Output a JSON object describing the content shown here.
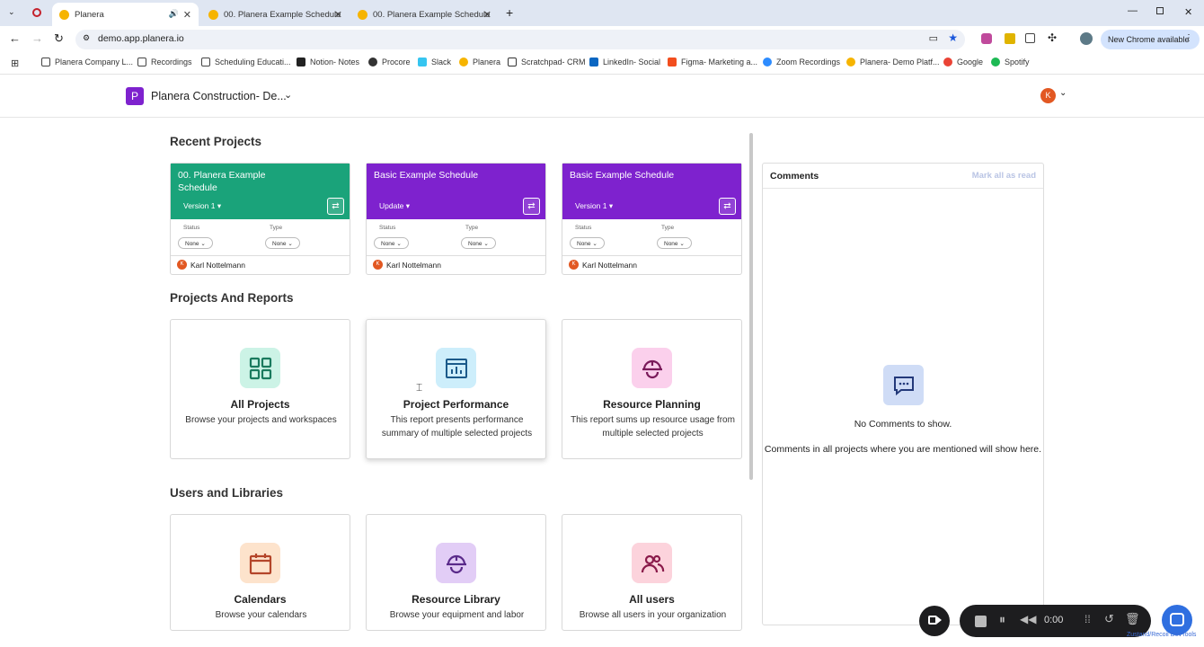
{
  "browser": {
    "tabs": [
      {
        "label": "Planera"
      },
      {
        "label": "00. Planera Example Schedule"
      },
      {
        "label": "00. Planera Example Schedule"
      }
    ],
    "url": "demo.app.planera.io",
    "new_chrome": "New Chrome available",
    "bookmarks": [
      "Planera Company L...",
      "Recordings",
      "Scheduling Educati...",
      "Notion- Notes",
      "Procore",
      "Slack",
      "Planera",
      "Scratchpad- CRM",
      "LinkedIn- Social",
      "Figma- Marketing a...",
      "Zoom Recordings",
      "Planera- Demo Platf...",
      "Google",
      "Spotify"
    ]
  },
  "header": {
    "workspace": "Planera Construction- De...",
    "logo_letter": "P",
    "avatar_letter": "K"
  },
  "recent": {
    "title": "Recent Projects",
    "cards": [
      {
        "name": "00. Planera Example Schedule",
        "version": "Version 1",
        "color": "#1aa37a",
        "status_label": "Status",
        "status": "None",
        "type_label": "Type",
        "type": "None",
        "owner": "Karl Nottelmann"
      },
      {
        "name": "Basic Example Schedule",
        "version": "Update",
        "color": "#7e22ce",
        "status_label": "Status",
        "status": "None",
        "type_label": "Type",
        "type": "None",
        "owner": "Karl Nottelmann"
      },
      {
        "name": "Basic Example Schedule",
        "version": "Version 1",
        "color": "#7e22ce",
        "status_label": "Status",
        "status": "None",
        "type_label": "Type",
        "type": "None",
        "owner": "Karl Nottelmann"
      }
    ]
  },
  "reports": {
    "title": "Projects And Reports",
    "items": [
      {
        "title": "All Projects",
        "desc": "Browse your projects and workspaces"
      },
      {
        "title": "Project Performance",
        "desc": "This report presents performance summary of multiple selected projects"
      },
      {
        "title": "Resource Planning",
        "desc": "This report sums up resource usage from multiple selected projects"
      }
    ]
  },
  "users": {
    "title": "Users and Libraries",
    "items": [
      {
        "title": "Calendars",
        "desc": "Browse your calendars"
      },
      {
        "title": "Resource Library",
        "desc": "Browse your equipment and labor"
      },
      {
        "title": "All users",
        "desc": "Browse all users in your organization"
      }
    ]
  },
  "comments": {
    "title": "Comments",
    "mark_all": "Mark all as read",
    "empty": "No Comments to show.",
    "hint": "Comments in all projects where you are mentioned will show here."
  },
  "recorder": {
    "time": "0:00"
  },
  "footer_text": "Zustand/Recoil DevTools"
}
